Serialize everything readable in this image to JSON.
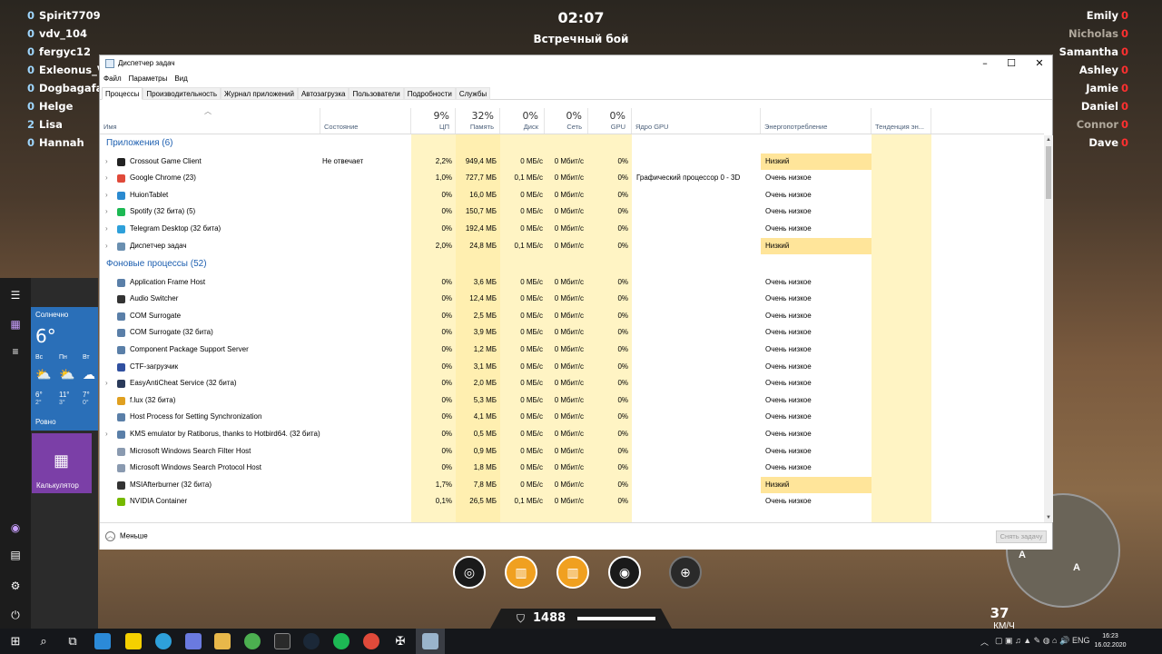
{
  "game": {
    "timer": "02:07",
    "mode": "Встречный бой",
    "team_left": [
      {
        "score": "0",
        "name": "Spirit77093"
      },
      {
        "score": "0",
        "name": "vdv_104"
      },
      {
        "score": "0",
        "name": "fergyc12"
      },
      {
        "score": "0",
        "name": "Exleonus_V"
      },
      {
        "score": "0",
        "name": "Dogbagafa"
      },
      {
        "score": "0",
        "name": "Helge"
      },
      {
        "score": "2",
        "name": "Lisa"
      },
      {
        "score": "0",
        "name": "Hannah"
      }
    ],
    "team_right": [
      {
        "name": "Emily",
        "score": "0"
      },
      {
        "name": "Nicholas",
        "score": "0"
      },
      {
        "name": "Samantha",
        "score": "0"
      },
      {
        "name": "Ashley",
        "score": "0"
      },
      {
        "name": "Jamie",
        "score": "0"
      },
      {
        "name": "Daniel",
        "score": "0"
      },
      {
        "name": "Connor",
        "score": "0"
      },
      {
        "name": "Dave",
        "score": "0"
      }
    ],
    "durability": "1488",
    "speed": "37",
    "speed_unit": "КМ/Ч",
    "minimap_markers": [
      "A",
      "A"
    ]
  },
  "start_menu": {
    "weather": {
      "condition": "Солнечно",
      "temp": "6°",
      "days": [
        "Вс",
        "Пн",
        "Вт"
      ],
      "highs": [
        "6°",
        "11°",
        "7°"
      ],
      "lows": [
        "2°",
        "3°",
        "0°"
      ],
      "location": "Ровно"
    },
    "calc_label": "Калькулятор"
  },
  "task_manager": {
    "title": "Диспетчер задач",
    "menu": [
      "Файл",
      "Параметры",
      "Вид"
    ],
    "tabs": [
      "Процессы",
      "Производительность",
      "Журнал приложений",
      "Автозагрузка",
      "Пользователи",
      "Подробности",
      "Службы"
    ],
    "columns": {
      "name": "Имя",
      "status": "Состояние",
      "cpu": {
        "pct": "9%",
        "label": "ЦП"
      },
      "mem": {
        "pct": "32%",
        "label": "Память"
      },
      "disk": {
        "pct": "0%",
        "label": "Диск"
      },
      "net": {
        "pct": "0%",
        "label": "Сеть"
      },
      "gpu": {
        "pct": "0%",
        "label": "GPU"
      },
      "gpu_engine": "Ядро GPU",
      "power": "Энергопотребление",
      "power_trend": "Тенденция эн..."
    },
    "apps_group": "Приложения (6)",
    "apps": [
      {
        "name": "Crossout Game Client",
        "status": "Не отвечает",
        "cpu": "2,2%",
        "mem": "949,4 МБ",
        "disk": "0 МБ/с",
        "net": "0 Мбит/с",
        "gpu": "0%",
        "engine": "",
        "power": "Низкий",
        "expand": true,
        "icon": "crossout-icon",
        "color": "#222222"
      },
      {
        "name": "Google Chrome (23)",
        "status": "",
        "cpu": "1,0%",
        "mem": "727,7 МБ",
        "disk": "0,1 МБ/с",
        "net": "0 Мбит/с",
        "gpu": "0%",
        "engine": "Графический процессор 0 - 3D",
        "power": "Очень низкое",
        "expand": true,
        "icon": "chrome-icon",
        "color": "#e04a3a"
      },
      {
        "name": "HuionTablet",
        "status": "",
        "cpu": "0%",
        "mem": "16,0 МБ",
        "disk": "0 МБ/с",
        "net": "0 Мбит/с",
        "gpu": "0%",
        "engine": "",
        "power": "Очень низкое",
        "expand": true,
        "icon": "huion-icon",
        "color": "#2a8ad0"
      },
      {
        "name": "Spotify (32 бита) (5)",
        "status": "",
        "cpu": "0%",
        "mem": "150,7 МБ",
        "disk": "0 МБ/с",
        "net": "0 Мбит/с",
        "gpu": "0%",
        "engine": "",
        "power": "Очень низкое",
        "expand": true,
        "icon": "spotify-icon",
        "color": "#1db954"
      },
      {
        "name": "Telegram Desktop (32 бита)",
        "status": "",
        "cpu": "0%",
        "mem": "192,4 МБ",
        "disk": "0 МБ/с",
        "net": "0 Мбит/с",
        "gpu": "0%",
        "engine": "",
        "power": "Очень низкое",
        "expand": true,
        "icon": "telegram-icon",
        "color": "#2ea0da"
      },
      {
        "name": "Диспетчер задач",
        "status": "",
        "cpu": "2,0%",
        "mem": "24,8 МБ",
        "disk": "0,1 МБ/с",
        "net": "0 Мбит/с",
        "gpu": "0%",
        "engine": "",
        "power": "Низкий",
        "expand": true,
        "icon": "task-manager-icon",
        "color": "#6a8fb0"
      }
    ],
    "bg_group": "Фоновые процессы (52)",
    "background": [
      {
        "name": "Application Frame Host",
        "cpu": "0%",
        "mem": "3,6 МБ",
        "disk": "0 МБ/с",
        "net": "0 Мбит/с",
        "gpu": "0%",
        "power": "Очень низкое",
        "expand": false,
        "icon": "app-frame-icon",
        "color": "#5a7fa8"
      },
      {
        "name": "Audio Switcher",
        "cpu": "0%",
        "mem": "12,4 МБ",
        "disk": "0 МБ/с",
        "net": "0 Мбит/с",
        "gpu": "0%",
        "power": "Очень низкое",
        "expand": false,
        "icon": "audio-switcher-icon",
        "color": "#333333"
      },
      {
        "name": "COM Surrogate",
        "cpu": "0%",
        "mem": "2,5 МБ",
        "disk": "0 МБ/с",
        "net": "0 Мбит/с",
        "gpu": "0%",
        "power": "Очень низкое",
        "expand": false,
        "icon": "com-surrogate-icon",
        "color": "#5a7fa8"
      },
      {
        "name": "COM Surrogate (32 бита)",
        "cpu": "0%",
        "mem": "3,9 МБ",
        "disk": "0 МБ/с",
        "net": "0 Мбит/с",
        "gpu": "0%",
        "power": "Очень низкое",
        "expand": false,
        "icon": "com-surrogate-icon",
        "color": "#5a7fa8"
      },
      {
        "name": "Component Package Support Server",
        "cpu": "0%",
        "mem": "1,2 МБ",
        "disk": "0 МБ/с",
        "net": "0 Мбит/с",
        "gpu": "0%",
        "power": "Очень низкое",
        "expand": false,
        "icon": "component-package-icon",
        "color": "#5a7fa8"
      },
      {
        "name": "CTF-загрузчик",
        "cpu": "0%",
        "mem": "3,1 МБ",
        "disk": "0 МБ/с",
        "net": "0 Мбит/с",
        "gpu": "0%",
        "power": "Очень низкое",
        "expand": false,
        "icon": "ctf-loader-icon",
        "color": "#3050a0"
      },
      {
        "name": "EasyAntiCheat Service (32 бита)",
        "cpu": "0%",
        "mem": "2,0 МБ",
        "disk": "0 МБ/с",
        "net": "0 Мбит/с",
        "gpu": "0%",
        "power": "Очень низкое",
        "expand": true,
        "icon": "easyanticheat-icon",
        "color": "#2a3a5a"
      },
      {
        "name": "f.lux (32 бита)",
        "cpu": "0%",
        "mem": "5,3 МБ",
        "disk": "0 МБ/с",
        "net": "0 Мбит/с",
        "gpu": "0%",
        "power": "Очень низкое",
        "expand": false,
        "icon": "flux-icon",
        "color": "#e0a020"
      },
      {
        "name": "Host Process for Setting Synchronization",
        "cpu": "0%",
        "mem": "4,1 МБ",
        "disk": "0 МБ/с",
        "net": "0 Мбит/с",
        "gpu": "0%",
        "power": "Очень низкое",
        "expand": false,
        "icon": "host-process-icon",
        "color": "#5a7fa8"
      },
      {
        "name": "KMS emulator by Ratiborus, thanks to Hotbird64. (32 бита)",
        "cpu": "0%",
        "mem": "0,5 МБ",
        "disk": "0 МБ/с",
        "net": "0 Мбит/с",
        "gpu": "0%",
        "power": "Очень низкое",
        "expand": true,
        "icon": "kms-emulator-icon",
        "color": "#5a7fa8"
      },
      {
        "name": "Microsoft Windows Search Filter Host",
        "cpu": "0%",
        "mem": "0,9 МБ",
        "disk": "0 МБ/с",
        "net": "0 Мбит/с",
        "gpu": "0%",
        "power": "Очень низкое",
        "expand": false,
        "icon": "search-filter-icon",
        "color": "#8a9ab0"
      },
      {
        "name": "Microsoft Windows Search Protocol Host",
        "cpu": "0%",
        "mem": "1,8 МБ",
        "disk": "0 МБ/с",
        "net": "0 Мбит/с",
        "gpu": "0%",
        "power": "Очень низкое",
        "expand": false,
        "icon": "search-protocol-icon",
        "color": "#8a9ab0"
      },
      {
        "name": "MSIAfterburner (32 бита)",
        "cpu": "1,7%",
        "mem": "7,8 МБ",
        "disk": "0 МБ/с",
        "net": "0 Мбит/с",
        "gpu": "0%",
        "power": "Низкий",
        "expand": false,
        "icon": "msi-afterburner-icon",
        "color": "#333333"
      },
      {
        "name": "NVIDIA Container",
        "cpu": "0,1%",
        "mem": "26,5 МБ",
        "disk": "0,1 МБ/с",
        "net": "0 Мбит/с",
        "gpu": "0%",
        "power": "Очень низкое",
        "expand": false,
        "icon": "nvidia-icon",
        "color": "#76b900"
      }
    ],
    "fewer_label": "Меньше",
    "end_task_label": "Снять задачу"
  },
  "taskbar": {
    "language": "ENG",
    "time": "16:23",
    "date": "16.02.2020"
  },
  "colors": {
    "group_blue": "#1d5fb0",
    "cpu_shade": "#fff4c4",
    "mem_shade": "#ffefb0",
    "power_low_fill": "#ffe59a",
    "enemy_score_red": "#ff3030",
    "calc_tile": "#7b3fa7",
    "weather_tile": "#2a6fb8"
  }
}
